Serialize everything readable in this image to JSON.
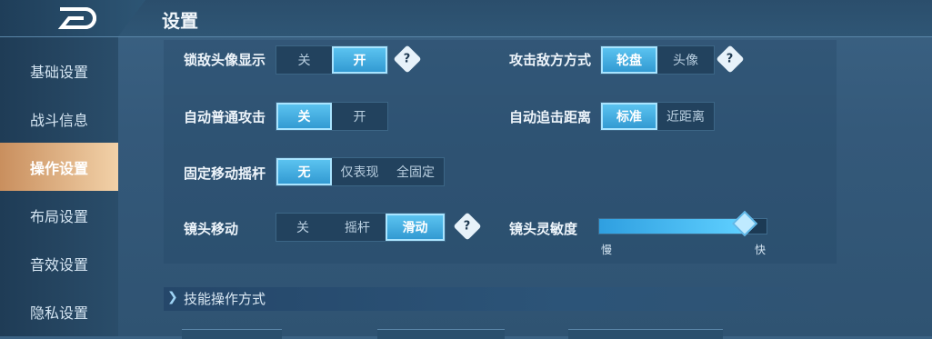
{
  "header": {
    "title": "设置"
  },
  "sidebar": {
    "items": [
      {
        "label": "基础设置"
      },
      {
        "label": "战斗信息"
      },
      {
        "label": "操作设置"
      },
      {
        "label": "布局设置"
      },
      {
        "label": "音效设置"
      },
      {
        "label": "隐私设置"
      }
    ],
    "active": "操作设置"
  },
  "settings": {
    "lock_enemy_avatar": {
      "label": "锁敌头像显示",
      "options": [
        "关",
        "开"
      ],
      "selected": "开"
    },
    "attack_mode": {
      "label": "攻击敌方方式",
      "options": [
        "轮盘",
        "头像"
      ],
      "selected": "轮盘"
    },
    "auto_attack": {
      "label": "自动普通攻击",
      "options": [
        "关",
        "开"
      ],
      "selected": "关"
    },
    "auto_chase": {
      "label": "自动追击距离",
      "options": [
        "标准",
        "近距离"
      ],
      "selected": "标准"
    },
    "fixed_joystick": {
      "label": "固定移动摇杆",
      "options": [
        "无",
        "仅表现",
        "全固定"
      ],
      "selected": "无"
    },
    "camera_move": {
      "label": "镜头移动",
      "options": [
        "关",
        "摇杆",
        "滑动"
      ],
      "selected": "滑动"
    },
    "camera_sensitivity": {
      "label": "镜头灵敏度",
      "min_label": "慢",
      "max_label": "快",
      "value": 0.87
    }
  },
  "help_glyph": "?",
  "section": {
    "title": "技能操作方式"
  },
  "colors": {
    "accent": "#3fb2e8",
    "active_tab": "#e0b07c"
  }
}
